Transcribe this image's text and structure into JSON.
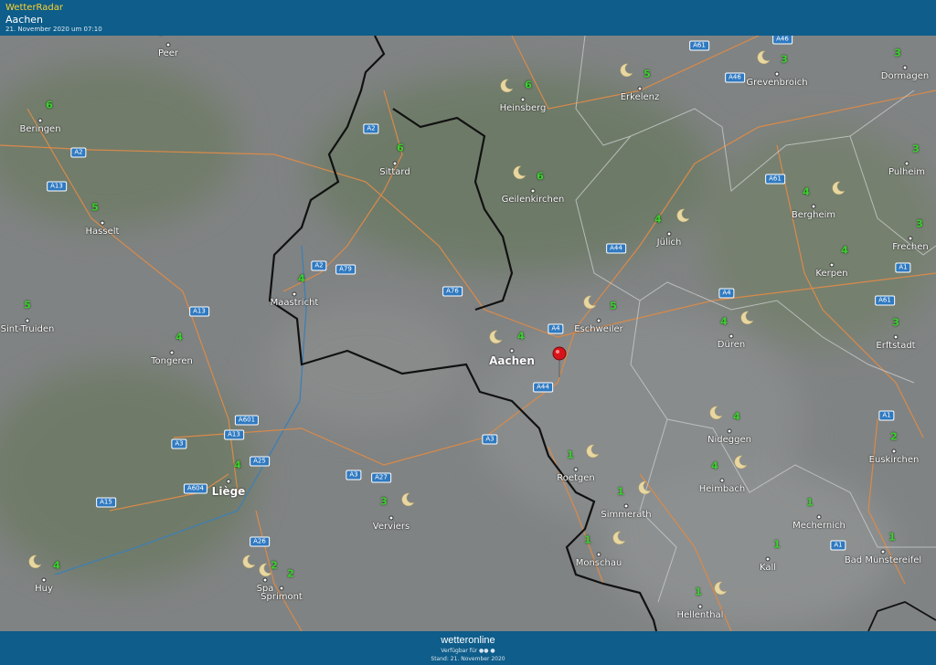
{
  "header": {
    "app_name": "WetterRadar",
    "location": "Aachen",
    "timestamp": "21. November 2020 um 07:10"
  },
  "footer": {
    "logo": "wetteronline",
    "availability": "Verfügbar für ●● ●",
    "stand": "Stand: 21. November 2020"
  },
  "cities": [
    {
      "name": "Peer",
      "value": "6",
      "moon": false,
      "big": false
    },
    {
      "name": "Beringen",
      "value": "6",
      "moon": false,
      "big": false
    },
    {
      "name": "Hasselt",
      "value": "5",
      "moon": false,
      "big": false
    },
    {
      "name": "Sint-Truiden",
      "value": "5",
      "moon": false,
      "big": false
    },
    {
      "name": "Tongeren",
      "value": "4",
      "moon": false,
      "big": false
    },
    {
      "name": "Maastricht",
      "value": "4",
      "moon": false,
      "big": false
    },
    {
      "name": "Sittard",
      "value": "6",
      "moon": false,
      "big": false
    },
    {
      "name": "Heinsberg",
      "value": "6",
      "moon": true,
      "big": false
    },
    {
      "name": "Erkelenz",
      "value": "5",
      "moon": true,
      "big": false
    },
    {
      "name": "Grevenbroich",
      "value": "3",
      "moon": true,
      "big": false
    },
    {
      "name": "Dormagen",
      "value": "3",
      "moon": false,
      "big": false
    },
    {
      "name": "Geilenkirchen",
      "value": "6",
      "moon": true,
      "big": false
    },
    {
      "name": "Jülich",
      "value": "4",
      "moon": true,
      "big": false
    },
    {
      "name": "Bergheim",
      "value": "4",
      "moon": true,
      "big": false
    },
    {
      "name": "Pulheim",
      "value": "3",
      "moon": false,
      "big": false
    },
    {
      "name": "Frechen",
      "value": "3",
      "moon": false,
      "big": false
    },
    {
      "name": "Kerpen",
      "value": "4",
      "moon": false,
      "big": false
    },
    {
      "name": "Eschweiler",
      "value": "5",
      "moon": true,
      "big": false
    },
    {
      "name": "Aachen",
      "value": "4",
      "moon": true,
      "big": true
    },
    {
      "name": "Düren",
      "value": "4",
      "moon": true,
      "big": false
    },
    {
      "name": "Erftstadt",
      "value": "3",
      "moon": false,
      "big": false
    },
    {
      "name": "Nideggen",
      "value": "4",
      "moon": true,
      "big": false
    },
    {
      "name": "Euskirchen",
      "value": "2",
      "moon": false,
      "big": false
    },
    {
      "name": "Roetgen",
      "value": "1",
      "moon": true,
      "big": false
    },
    {
      "name": "Heimbach",
      "value": "4",
      "moon": true,
      "big": false
    },
    {
      "name": "Simmerath",
      "value": "1",
      "moon": true,
      "big": false
    },
    {
      "name": "Mechernich",
      "value": "1",
      "moon": false,
      "big": false
    },
    {
      "name": "Monschau",
      "value": "1",
      "moon": true,
      "big": false
    },
    {
      "name": "Kall",
      "value": "1",
      "moon": false,
      "big": false
    },
    {
      "name": "Bad Münstereifel",
      "value": "1",
      "moon": false,
      "big": false
    },
    {
      "name": "Hellenthal",
      "value": "1",
      "moon": true,
      "big": false
    },
    {
      "name": "Liège",
      "value": "4",
      "moon": false,
      "big": true
    },
    {
      "name": "Verviers",
      "value": "3",
      "moon": true,
      "big": false
    },
    {
      "name": "Spa",
      "value": "2",
      "moon": true,
      "big": false
    },
    {
      "name": "Sprimont",
      "value": "2",
      "moon": true,
      "big": false
    },
    {
      "name": "Huy",
      "value": "4",
      "moon": true,
      "big": false
    }
  ],
  "roads": [
    "A61",
    "A46",
    "A46",
    "A2",
    "A2",
    "A13",
    "A61",
    "A44",
    "A4",
    "A79",
    "A76",
    "A2",
    "A13",
    "A4",
    "A61",
    "A44",
    "A3",
    "A1",
    "A1",
    "A601",
    "A13",
    "A3",
    "A25",
    "A604",
    "A3",
    "A27",
    "A15",
    "A26",
    "A1"
  ],
  "colors": {
    "bar": "#0e5d8a",
    "accent": "#ffd12a",
    "temp": "#3ad12d",
    "road_sign": "#2f79c0",
    "border": "#111111",
    "road": "#d98a4a"
  }
}
